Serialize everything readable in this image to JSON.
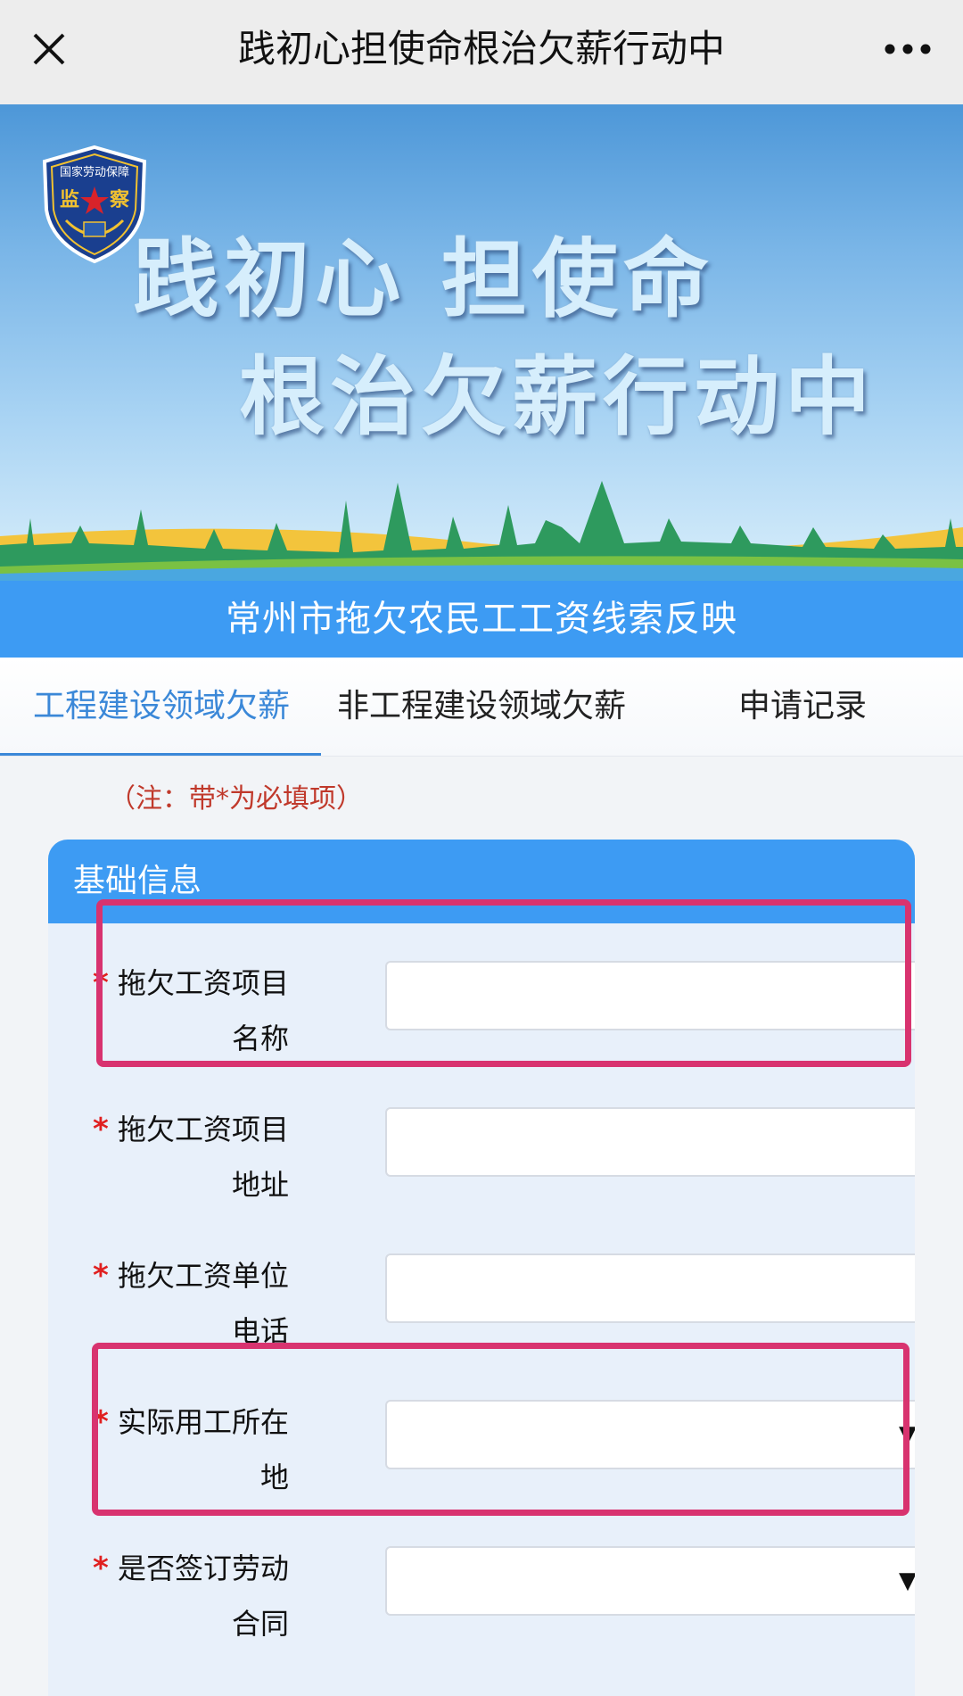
{
  "nav": {
    "title": "践初心担使命根治欠薪行动中",
    "close_icon": "close-icon",
    "more_icon": "more-dots-icon"
  },
  "banner": {
    "emblem": {
      "top_text": "国家劳动保障",
      "left_char": "监",
      "right_char": "察"
    },
    "line1": "践初心 担使命",
    "line2": "根治欠薪行动中"
  },
  "strip_title": "常州市拖欠农民工工资线索反映",
  "tabs": [
    {
      "label": "工程建设领域欠薪",
      "active": true
    },
    {
      "label": "非工程建设领域欠薪",
      "active": false
    },
    {
      "label": "申请记录",
      "active": false
    }
  ],
  "note": "（注：带*为必填项）",
  "card": {
    "header": "基础信息",
    "fields": [
      {
        "star": "*",
        "line1": "拖欠工资项目",
        "line2": "名称",
        "type": "text",
        "value": "",
        "placeholder": ""
      },
      {
        "star": "*",
        "line1": "拖欠工资项目",
        "line2": "地址",
        "type": "text",
        "value": "",
        "placeholder": ""
      },
      {
        "star": "*",
        "line1": "拖欠工资单位",
        "line2": "电话",
        "type": "text",
        "value": "",
        "placeholder": ""
      },
      {
        "star": "*",
        "line1": "实际用工所在",
        "line2": "地",
        "type": "select",
        "value": "",
        "arrow": "▼"
      },
      {
        "star": "*",
        "line1": "是否签订劳动",
        "line2": "合同",
        "type": "select",
        "value": "",
        "arrow": "▼"
      }
    ]
  },
  "colors": {
    "primary_blue": "#3d9bf3",
    "active_tab": "#3b88d8",
    "required_star": "#e02020",
    "note_red": "#c0392b",
    "highlight_pink": "#d8336f"
  }
}
